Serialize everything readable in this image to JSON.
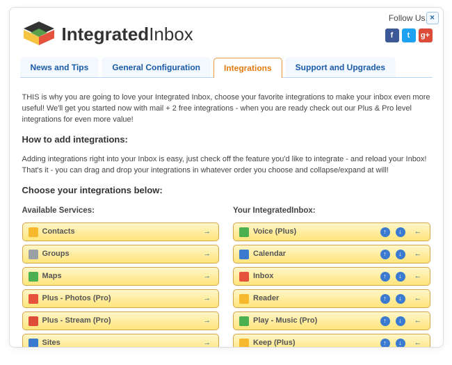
{
  "header": {
    "brand_bold": "Integrated",
    "brand_light": "Inbox",
    "follow_label": "Follow Us...",
    "close_glyph": "×",
    "social_fb": "f",
    "social_tw": "t",
    "social_gp": "g+"
  },
  "tabs": [
    {
      "label": "News and Tips",
      "active": false
    },
    {
      "label": "General Configuration",
      "active": false
    },
    {
      "label": "Integrations",
      "active": true
    },
    {
      "label": "Support and Upgrades",
      "active": false
    }
  ],
  "content": {
    "intro": "THIS is why you are going to love your Integrated Inbox, choose your favorite integrations to make your inbox even more useful! We'll get you started now with mail + 2 free integrations - when you are ready check out our Plus & Pro level integrations for even more value!",
    "how_heading": "How to add integrations:",
    "how_text": "Adding integrations right into your Inbox is easy, just check off the feature you'd like to integrate - and reload your Inbox! That's it - you can drag and drop your integrations in whatever order you choose and collapse/expand at will!",
    "choose_heading": "Choose your integrations below:"
  },
  "columns": {
    "left_title": "Available Services:",
    "right_title": "Your IntegratedInbox:"
  },
  "available": [
    {
      "label": "Contacts",
      "color": "#f6b92e"
    },
    {
      "label": "Groups",
      "color": "#9aa0a6"
    },
    {
      "label": "Maps",
      "color": "#4caf50"
    },
    {
      "label": "Plus - Photos (Pro)",
      "color": "#e5533c"
    },
    {
      "label": "Plus - Stream (Pro)",
      "color": "#dd4b39"
    },
    {
      "label": "Sites",
      "color": "#3a7bcf"
    }
  ],
  "inbox": [
    {
      "label": "Voice (Plus)",
      "color": "#4caf50"
    },
    {
      "label": "Calendar",
      "color": "#3a7bcf"
    },
    {
      "label": "Inbox",
      "color": "#e5533c"
    },
    {
      "label": "Reader",
      "color": "#f6b92e"
    },
    {
      "label": "Play - Music (Pro)",
      "color": "#4caf50"
    },
    {
      "label": "Keep (Plus)",
      "color": "#f6b92e"
    }
  ],
  "glyphs": {
    "arrow_right": "→",
    "arrow_left": "←",
    "up": "↑",
    "down": "↓"
  }
}
